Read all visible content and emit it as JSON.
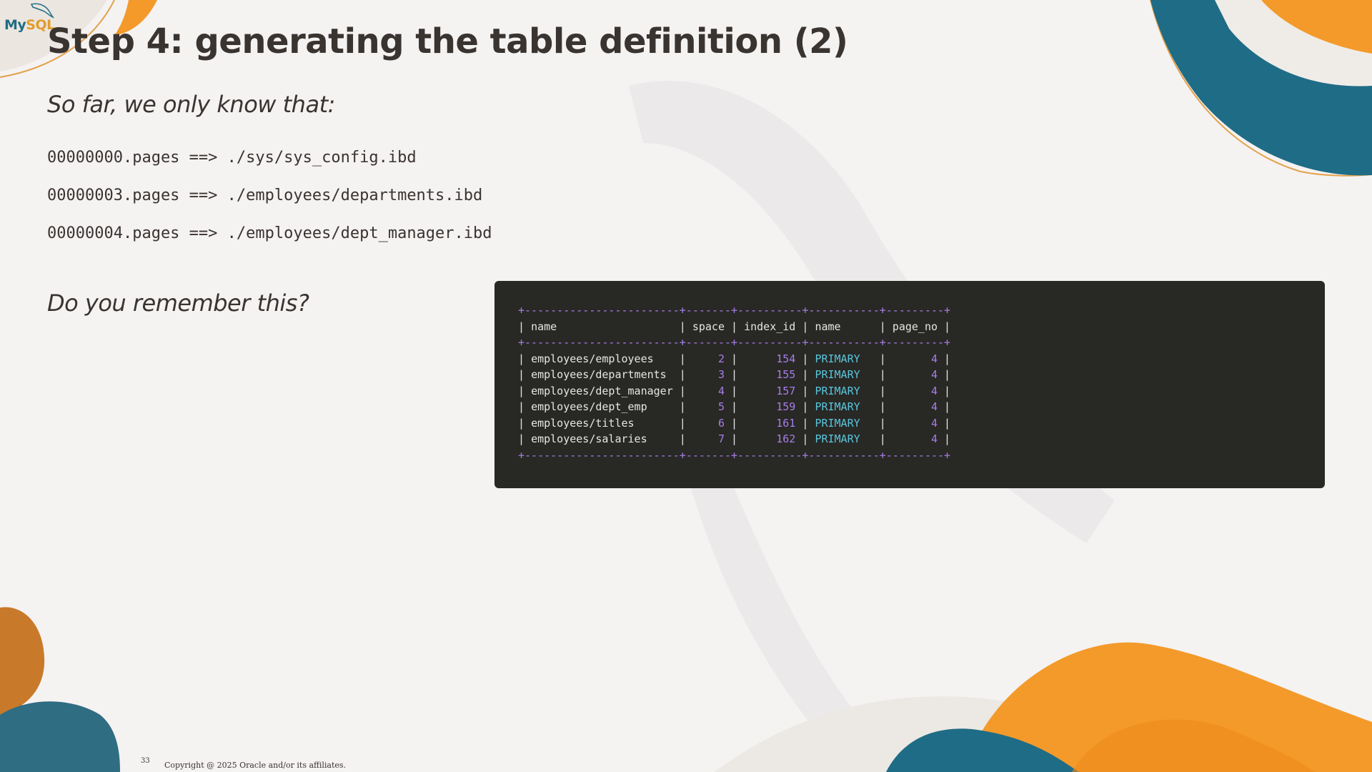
{
  "brand": {
    "logo_my": "My",
    "logo_sql": "SQL"
  },
  "colors": {
    "teal": "#1f6c86",
    "orange": "#f39a2a",
    "terminal_bg": "#282825",
    "number": "#a77ee8",
    "keyword": "#59c5dc"
  },
  "slide": {
    "title": "Step 4: generating the table definition (2)",
    "intro": "So far, we only know that:",
    "mappings": [
      "00000000.pages ==> ./sys/sys_config.ibd",
      "00000003.pages ==> ./employees/departments.ibd",
      "00000004.pages ==> ./employees/dept_manager.ibd"
    ],
    "question": "Do you remember this?"
  },
  "terminal": {
    "separator": "+------------------------+-------+----------+-----------+---------+",
    "headers": [
      "name",
      "space",
      "index_id",
      "name",
      "page_no"
    ],
    "rows": [
      [
        "employees/employees",
        "2",
        "154",
        "PRIMARY",
        "4"
      ],
      [
        "employees/departments",
        "3",
        "155",
        "PRIMARY",
        "4"
      ],
      [
        "employees/dept_manager",
        "4",
        "157",
        "PRIMARY",
        "4"
      ],
      [
        "employees/dept_emp",
        "5",
        "159",
        "PRIMARY",
        "4"
      ],
      [
        "employees/titles",
        "6",
        "161",
        "PRIMARY",
        "4"
      ],
      [
        "employees/salaries",
        "7",
        "162",
        "PRIMARY",
        "4"
      ]
    ]
  },
  "footer": {
    "page_number": "33",
    "copyright": "Copyright @ 2025 Oracle and/or its affiliates."
  }
}
